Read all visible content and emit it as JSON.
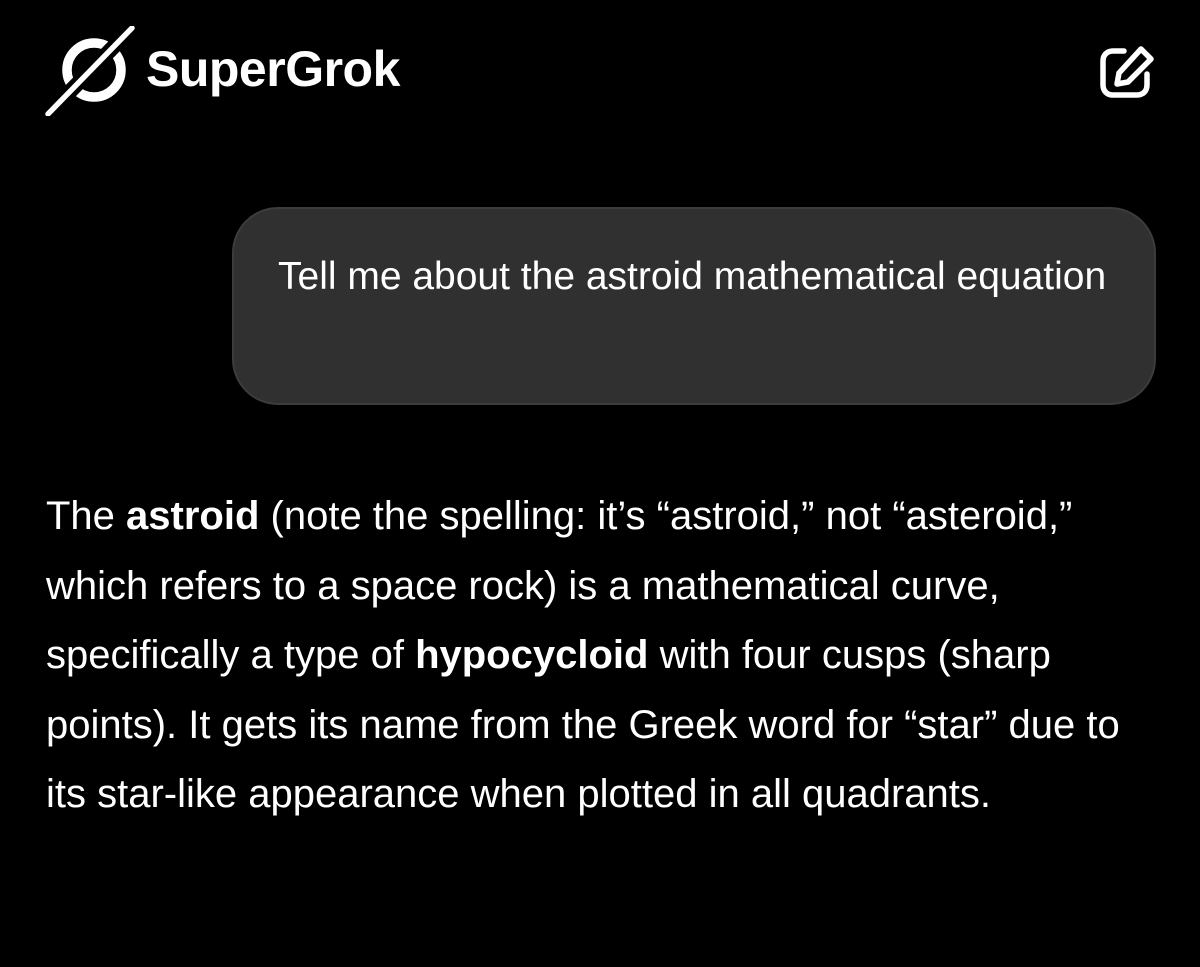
{
  "header": {
    "app_name": "SuperGrok",
    "logo_icon": "grok-logo-icon",
    "new_chat_icon": "edit-icon"
  },
  "conversation": {
    "user_message": "Tell me about the astroid mathematical equation",
    "response": {
      "seg1": "The ",
      "bold1": "astroid",
      "seg2": " (note the spelling: it’s “astroid,” not “asteroid,” which refers to a space rock) is a mathematical curve, specifically a type of ",
      "bold2": "hypocycloid",
      "seg3": " with four cusps (sharp points). It gets its name from the Greek word for “star” due to its star-like appearance when plotted in all quadrants."
    }
  },
  "colors": {
    "background": "#000000",
    "user_bubble": "#303030",
    "text": "#ffffff"
  }
}
